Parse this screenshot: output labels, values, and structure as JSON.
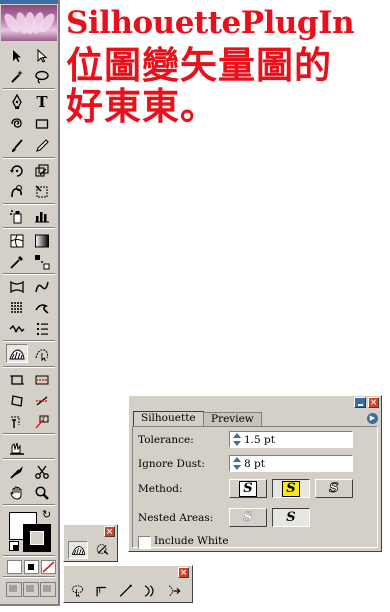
{
  "headline": {
    "line1": "SilhouettePlugIn",
    "line2": "位圖變矢量圖的",
    "line3": "好東東。"
  },
  "colors": {
    "headline": "#e8101a",
    "panel_bg": "#d4d0c8",
    "title_blue": "#3a6ea5",
    "close_red": "#d84020",
    "highlight_yellow": "#f8e820"
  },
  "toolbox": {
    "tools": [
      "selection-arrow",
      "direct-selection-arrow",
      "magic-wand",
      "lasso",
      "pen",
      "type",
      "spiral",
      "rectangle",
      "paintbrush",
      "pencil",
      "rotate",
      "scale",
      "warp",
      "free-transform",
      "symbol-sprayer",
      "column-graph",
      "mesh",
      "gradient",
      "eyedropper",
      "blend",
      "live-paint-bucket",
      "live-paint-selection",
      "crop-area",
      "slice",
      "shape-builder",
      "perspective-grid",
      "silhouette",
      "silhouette-select",
      "rect-frame",
      "rect-frame-2",
      "frame-alt",
      "frame-alt-2",
      "text-frame",
      "text-frame-2",
      "scissors-cut",
      "scissors",
      "hand",
      "zoom"
    ]
  },
  "mini_palette_1": {
    "icons": [
      "silhouette-shape-icon",
      "silhouette-sweep-icon"
    ],
    "close": "×"
  },
  "mini_palette_2": {
    "icons": [
      "lasso-select-icon",
      "corner-icon",
      "line-icon",
      "curve-icon",
      "curve-arrow-icon"
    ],
    "close": "×"
  },
  "panel": {
    "tabs": [
      "Silhouette",
      "Preview"
    ],
    "active_tab": "Silhouette",
    "close": "×",
    "fields": {
      "tolerance": {
        "label": "Tolerance:",
        "value": "1.5 pt"
      },
      "ignore_dust": {
        "label": "Ignore Dust:",
        "value": "8 pt"
      }
    },
    "method": {
      "label": "Method:",
      "options": [
        "S",
        "S",
        "S"
      ],
      "selected_index": 1
    },
    "nested_areas": {
      "label": "Nested Areas:",
      "options": [
        "S",
        "S"
      ],
      "selected_index": 1
    },
    "include_white": {
      "label": "Include White",
      "checked": false
    }
  }
}
